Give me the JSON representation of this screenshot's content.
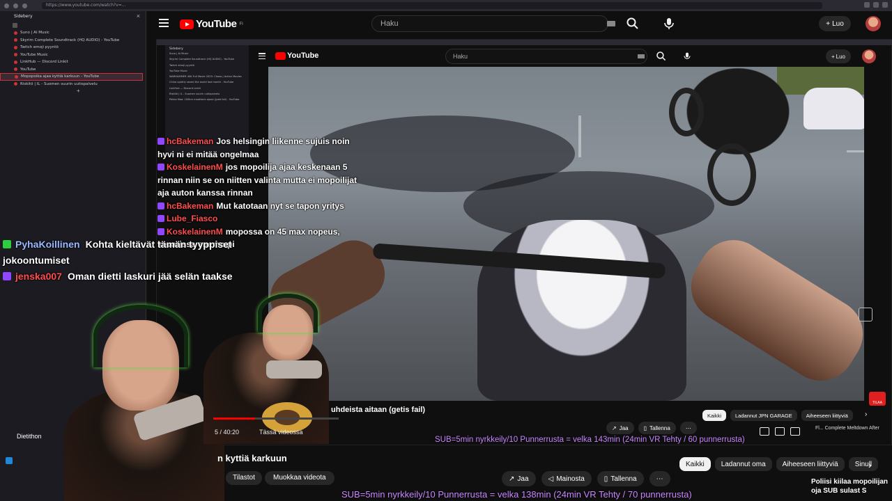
{
  "browser": {
    "url": "https://www.youtube.com/watch?v=..."
  },
  "sidebery": {
    "title": "Sidebery",
    "tabs": [
      "Suno | AI Music",
      "Skyrim Complete Soundtrack (HQ AUDIO) - YouTube",
      "Twitch emoji pyyntö",
      "YouTube Music",
      "LinkHub — Discord Linkit",
      "YouTube",
      "Mopopoika ajaa kyttiä karkuun - YouTube",
      "Riskitö | IL - Suomen suurin uutispalvelu"
    ],
    "active_index": 6
  },
  "header": {
    "logo": "YouTube",
    "region": "FI",
    "search_placeholder": "Haku",
    "create_label": "Luo"
  },
  "nested": {
    "sidebery_title": "Sidebery",
    "sidebery_tabs": [
      "Suno | AI Music",
      "Skyrim Complete Soundtrack (HQ AUDIO) - YouTube",
      "Twitch emoji pyyntö",
      "YouTube Music",
      "WARHAMMER 40K Full Movie 2025: Chaos | Action Movies",
      "China quietly saved the world last month - YouTube",
      "LinkHub — Discord Linkit",
      "Riskitö | IL - Suomen suurin uutispalvelu",
      "Pekka Maa: 100km moottorin ajaan (jpeb fail) - YouTube"
    ],
    "search_placeholder": "Haku",
    "create_label": "Luo",
    "title_snippet": "uhdeista aitaan (getis fail)",
    "time": "5 / 40:20",
    "in_video": "Tässä videossa",
    "actions": [
      "Jaa",
      "Tallenna"
    ],
    "chips": [
      "Kaikki",
      "Ladannut JPN GARAGE",
      "Aiheeseen liittyviä"
    ],
    "card": "Fl... Complete Meltdown After"
  },
  "chat_small": [
    {
      "user": "hcBakeman",
      "user_color": "#ff4d4d",
      "text": "Jos helsingin liikenne sujuis noin hyvi ni ei mitää ongelmaa"
    },
    {
      "user": "KoskelainenM",
      "user_color": "#ff4d4d",
      "text": "jos mopoilija ajaa keskenaan 5 rinnan niin se on niitten valinta mutta ei mopoilijat aja auton kanssa rinnan"
    },
    {
      "user": "hcBakeman",
      "user_color": "#ff4d4d",
      "text": "Mut katotaan nyt se tapon yritys"
    },
    {
      "user": "Lube_Fiasco",
      "user_color": "#ff4d4d",
      "text": ""
    },
    {
      "user": "KoskelainenM",
      "user_color": "#ff4d4d",
      "text": "mopossa on 45 max nopeus, kevarissa enemmpi"
    }
  ],
  "chat_big": [
    {
      "user": "PyhaKoillinen",
      "user_color": "#9ab8ff",
      "text": "Kohta kieltävät tämän tyyppiset jokoontumiset"
    },
    {
      "user": "jenska007",
      "user_color": "#ff4d4d",
      "text": "Oman dietti laskuri jää selän taakse"
    }
  ],
  "overlay": {
    "sub_line_top": "SUB=5min nyrkkeily/10 Punnerrusta = velka 143min (24min VR Tehty / 60 punnerrusta)",
    "sub_line_bottom": "SUB=5min nyrkkeily/10 Punnerrusta = velka 138min (24min VR Tehty / 70 punnerrusta)",
    "dietit_label": "Dietithon",
    "notification": "Poliisi kiilaa mopoilijan oja SUB sulast S",
    "tilaa": "TILAA"
  },
  "main": {
    "title_snippet": "n kyttiä karkuun",
    "stats_label": "Tilastot",
    "edit_label": "Muokkaa videota",
    "actions": [
      "Jaa",
      "Mainosta",
      "Tallenna"
    ],
    "chips": [
      "Kaikki",
      "Ladannut oma",
      "Aiheeseen liittyviä",
      "Sinull"
    ]
  },
  "colors": {
    "accent": "#ff0000",
    "sub_text": "#c986ff"
  }
}
